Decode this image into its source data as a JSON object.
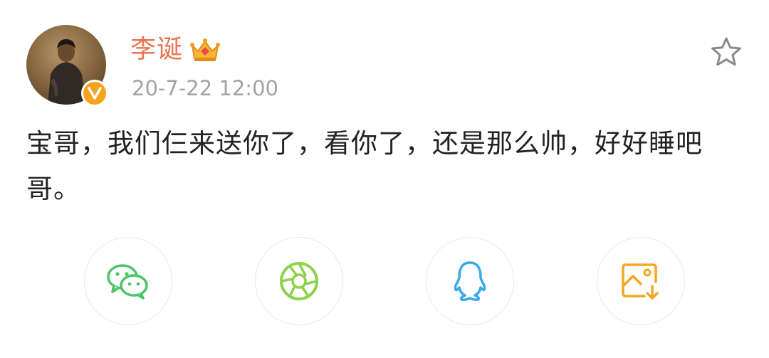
{
  "post": {
    "author": {
      "name": "李诞",
      "verified_badge": "V",
      "avatar_icon": "portrait-avatar",
      "membership_icon": "crown-icon"
    },
    "timestamp": "20-7-22 12:00",
    "favorite_icon": "star-outline-icon",
    "text": "宝哥，我们仨来送你了，看你了，还是那么帅，好好睡吧哥。"
  },
  "share": {
    "buttons": [
      {
        "name": "wechat",
        "icon": "wechat-icon",
        "color": "#4dc465"
      },
      {
        "name": "moments",
        "icon": "aperture-icon",
        "color": "#8ed14b"
      },
      {
        "name": "qq",
        "icon": "qq-penguin-icon",
        "color": "#3aa9e8"
      },
      {
        "name": "save-image",
        "icon": "image-download-icon",
        "color": "#f5a623"
      }
    ]
  },
  "colors": {
    "username": "#eb7350",
    "timestamp": "#a3a3a3",
    "badge": "#f6a21d"
  }
}
